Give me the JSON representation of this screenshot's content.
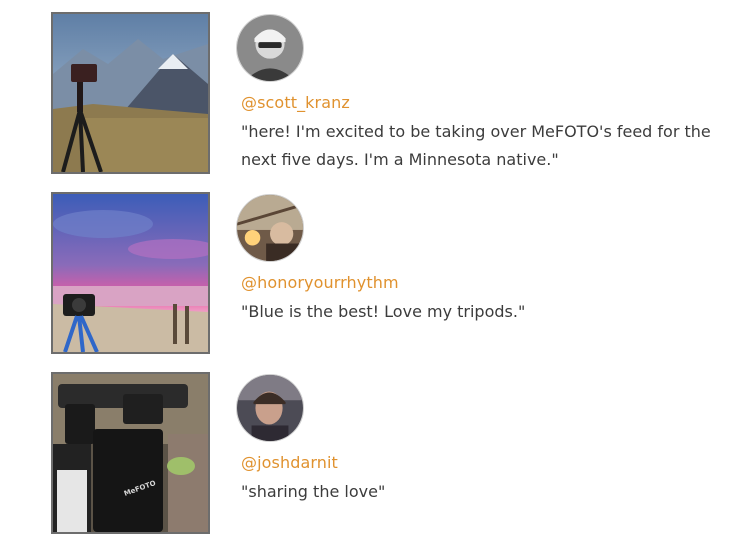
{
  "posts": [
    {
      "handle": "@scott_kranz",
      "quote": "\"here! I'm excited to be taking over MeFOTO's feed for the next five days. I'm a Minnesota native.\""
    },
    {
      "handle": "@honoryourrhythm",
      "quote": "\"Blue is the best! Love my tripods.\""
    },
    {
      "handle": "@joshdarnit",
      "quote": "\"sharing the love\"",
      "photo_brand_text": "MeFOTO"
    }
  ],
  "colors": {
    "handle": "#e0922f",
    "text": "#3c3c3c",
    "photo_border": "#6d6d6d"
  }
}
